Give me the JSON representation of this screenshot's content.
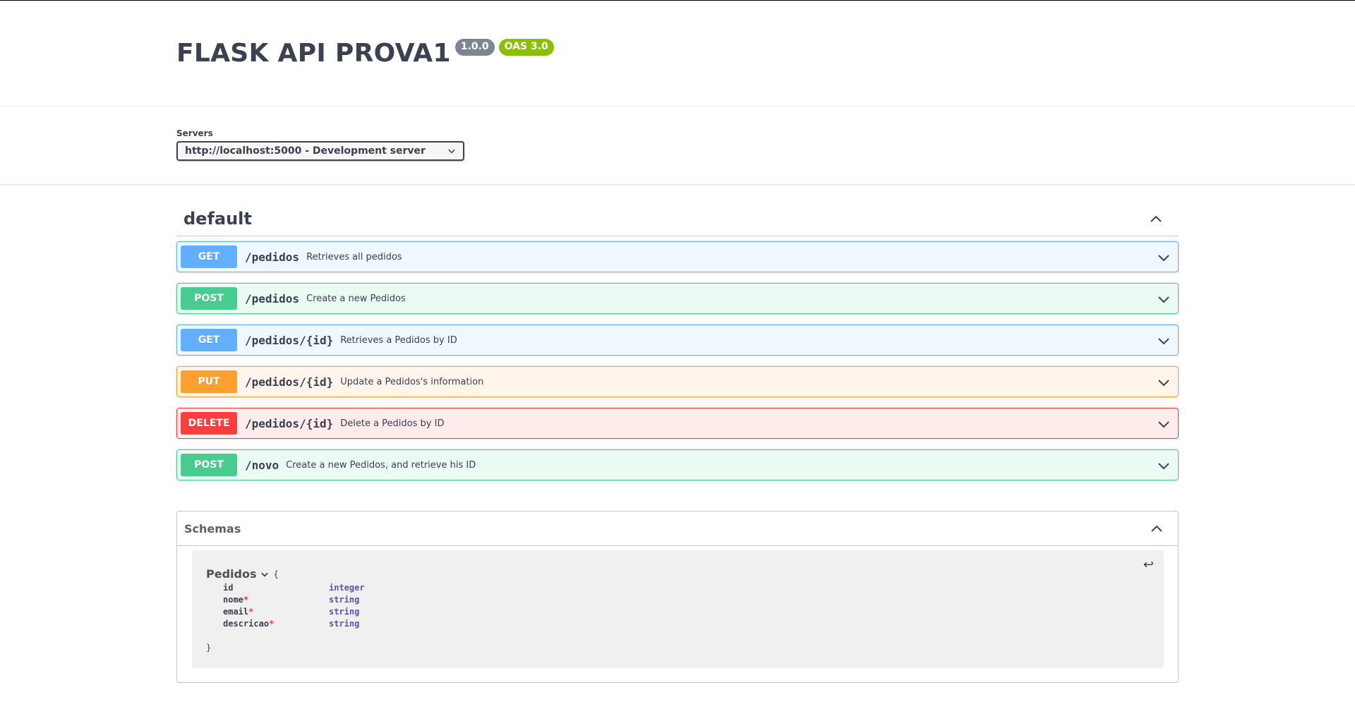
{
  "info": {
    "title": "FLASK API PROVA1",
    "version": "1.0.0",
    "oas": "OAS 3.0"
  },
  "servers": {
    "label": "Servers",
    "selected": "http://localhost:5000 - Development server"
  },
  "tag": {
    "name": "default"
  },
  "operations": [
    {
      "method": "GET",
      "path": "/pedidos",
      "summary": "Retrieves all pedidos"
    },
    {
      "method": "POST",
      "path": "/pedidos",
      "summary": "Create a new Pedidos"
    },
    {
      "method": "GET",
      "path": "/pedidos/{id}",
      "summary": "Retrieves a Pedidos by ID"
    },
    {
      "method": "PUT",
      "path": "/pedidos/{id}",
      "summary": "Update a Pedidos's information"
    },
    {
      "method": "DELETE",
      "path": "/pedidos/{id}",
      "summary": "Delete a Pedidos by ID"
    },
    {
      "method": "POST",
      "path": "/novo",
      "summary": "Create a new Pedidos, and retrieve his ID"
    }
  ],
  "schemas": {
    "title": "Schemas",
    "model": {
      "name": "Pedidos",
      "open_brace": "{",
      "close_brace": "}",
      "properties": [
        {
          "name": "id",
          "required": "",
          "type": "integer"
        },
        {
          "name": "nome",
          "required": "*",
          "type": "string"
        },
        {
          "name": "email",
          "required": "*",
          "type": "string"
        },
        {
          "name": "descricao",
          "required": "*",
          "type": "string"
        }
      ]
    }
  },
  "colors": {
    "get": "#61affe",
    "post": "#49cc90",
    "put": "#fca130",
    "delete": "#f93e3e",
    "version_badge": "#7d8492",
    "oas_badge": "#89bf04"
  },
  "icons": {
    "expand": "chevron-down-icon",
    "collapse": "chevron-up-icon",
    "wrap": "return-arrow-icon"
  }
}
